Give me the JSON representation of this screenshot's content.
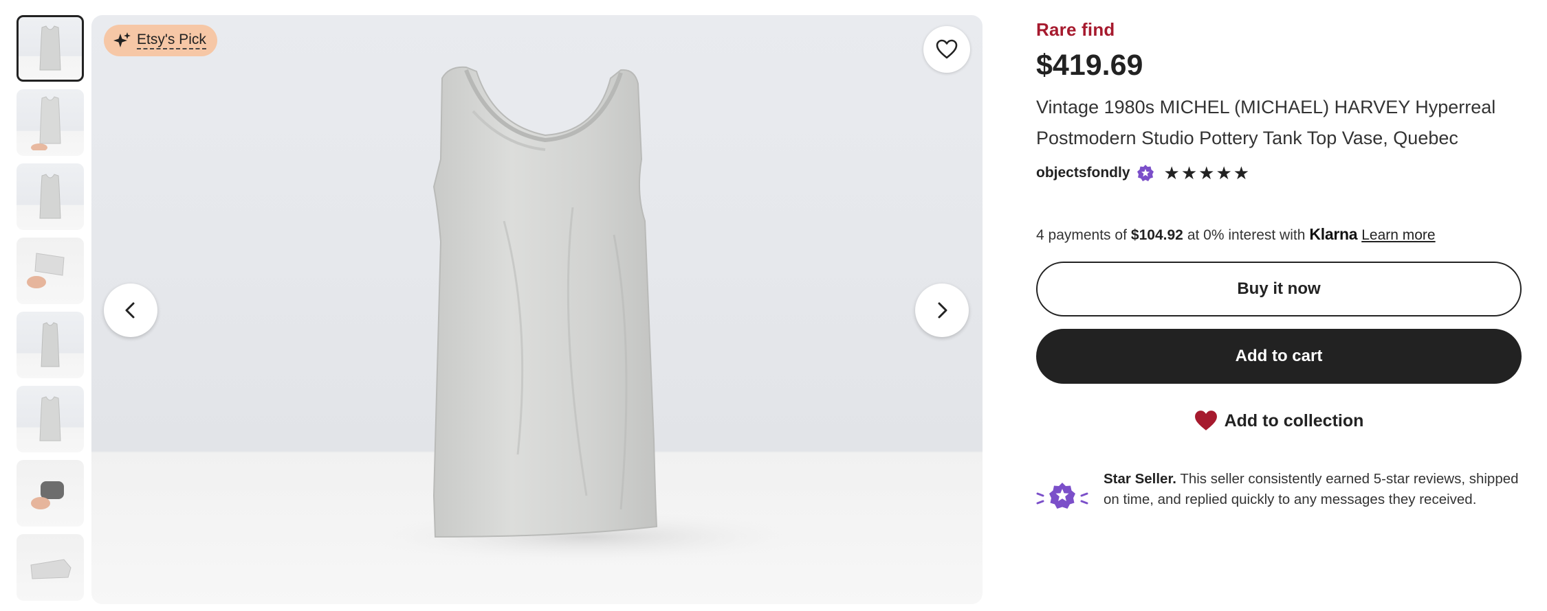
{
  "badge": {
    "label": "Etsy's Pick"
  },
  "thumbnails": [
    {
      "alt": "thumbnail-1"
    },
    {
      "alt": "thumbnail-2"
    },
    {
      "alt": "thumbnail-3"
    },
    {
      "alt": "thumbnail-4"
    },
    {
      "alt": "thumbnail-5"
    },
    {
      "alt": "thumbnail-6"
    },
    {
      "alt": "thumbnail-7"
    },
    {
      "alt": "thumbnail-8"
    }
  ],
  "product": {
    "tag": "Rare find",
    "price": "$419.69",
    "title": "Vintage 1980s MICHEL (MICHAEL) HARVEY Hyperreal Postmodern Studio Pottery Tank Top Vase, Quebec",
    "seller": "objectsfondly",
    "rating_stars": 5
  },
  "payment": {
    "prefix": "4 payments of",
    "amount": "$104.92",
    "middle": "at 0% interest with",
    "provider": "Klarna",
    "link": "Learn more"
  },
  "actions": {
    "buy_now": "Buy it now",
    "add_to_cart": "Add to cart",
    "add_to_collection": "Add to collection"
  },
  "star_seller": {
    "title": "Star Seller.",
    "text": "This seller consistently earned 5-star reviews, shipped on time, and replied quickly to any messages they received."
  },
  "colors": {
    "rare_red": "#a61a2e",
    "dark": "#222222",
    "badge_peach": "#f6c7a6",
    "star_seller_purple": "#7b4fc9",
    "heart_red": "#a61a2e"
  }
}
